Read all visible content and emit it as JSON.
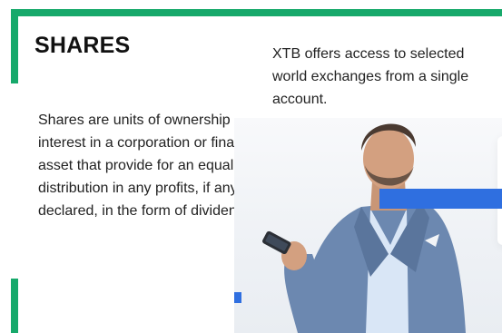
{
  "card": {
    "title": "SHARES",
    "side_copy": "XTB offers access to selected world exchanges from a single account.",
    "description": "Shares are units of ownership interest in a corporation or financial asset that provide for an equal distribution in any profits, if any are declared, in the form of dividends."
  },
  "colors": {
    "accent_green": "#17a96b",
    "accent_blue": "#2f6fe0",
    "text": "#222222"
  },
  "icons": {
    "photo": "man-with-phone-illustration"
  }
}
